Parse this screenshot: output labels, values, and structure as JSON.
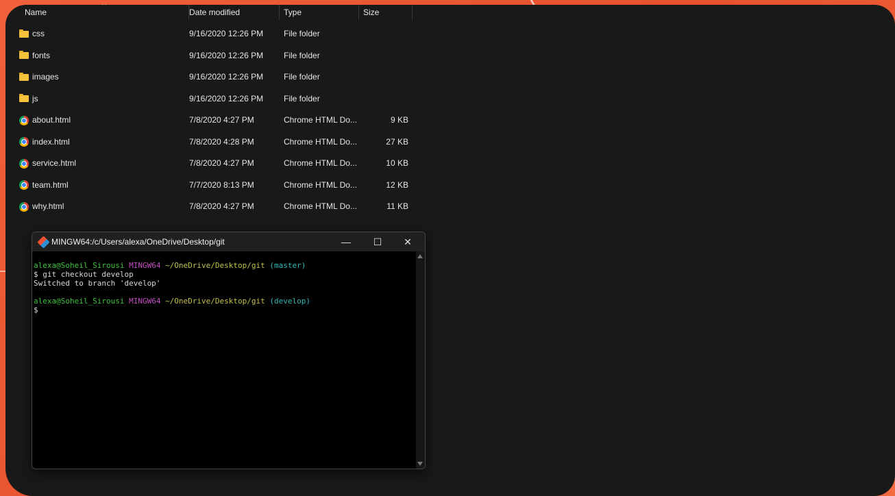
{
  "explorer": {
    "columns": {
      "name": "Name",
      "date": "Date modified",
      "type": "Type",
      "size": "Size"
    },
    "rows": [
      {
        "icon": "folder-icon",
        "name": "css",
        "date": "9/16/2020 12:26 PM",
        "type": "File folder",
        "size": ""
      },
      {
        "icon": "folder-icon",
        "name": "fonts",
        "date": "9/16/2020 12:26 PM",
        "type": "File folder",
        "size": ""
      },
      {
        "icon": "folder-icon",
        "name": "images",
        "date": "9/16/2020 12:26 PM",
        "type": "File folder",
        "size": ""
      },
      {
        "icon": "folder-icon",
        "name": "js",
        "date": "9/16/2020 12:26 PM",
        "type": "File folder",
        "size": ""
      },
      {
        "icon": "chrome-icon",
        "name": "about.html",
        "date": "7/8/2020 4:27 PM",
        "type": "Chrome HTML Do...",
        "size": "9 KB"
      },
      {
        "icon": "chrome-icon",
        "name": "index.html",
        "date": "7/8/2020 4:28 PM",
        "type": "Chrome HTML Do...",
        "size": "27 KB"
      },
      {
        "icon": "chrome-icon",
        "name": "service.html",
        "date": "7/8/2020 4:27 PM",
        "type": "Chrome HTML Do...",
        "size": "10 KB"
      },
      {
        "icon": "chrome-icon",
        "name": "team.html",
        "date": "7/7/2020 8:13 PM",
        "type": "Chrome HTML Do...",
        "size": "12 KB"
      },
      {
        "icon": "chrome-icon",
        "name": "why.html",
        "date": "7/8/2020 4:27 PM",
        "type": "Chrome HTML Do...",
        "size": "11 KB"
      }
    ]
  },
  "terminal": {
    "title": "MINGW64:/c/Users/alexa/OneDrive/Desktop/git",
    "controls": {
      "minimize": "—",
      "maximize": "☐",
      "close": "✕"
    },
    "prompt1": {
      "user": "alexa@Soheil_Sirousi",
      "host": "MINGW64",
      "path": "~/OneDrive/Desktop/git",
      "branch": "(master)"
    },
    "command": "$ git checkout develop",
    "output": "Switched to branch 'develop'",
    "prompt2": {
      "user": "alexa@Soheil_Sirousi",
      "host": "MINGW64",
      "path": "~/OneDrive/Desktop/git",
      "branch": "(develop)"
    },
    "cursor_line": "$"
  }
}
